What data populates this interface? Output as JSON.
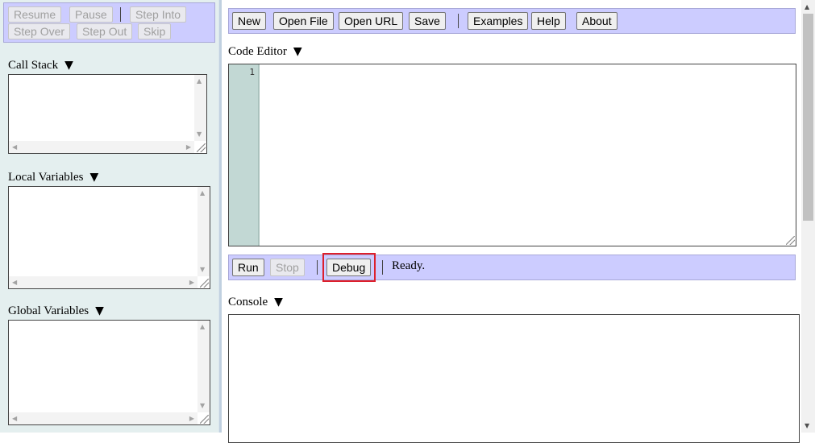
{
  "debug_toolbar": {
    "resume": "Resume",
    "pause": "Pause",
    "step_into": "Step Into",
    "step_over": "Step Over",
    "step_out": "Step Out",
    "skip": "Skip"
  },
  "left_panel": {
    "call_stack_label": "Call Stack",
    "local_variables_label": "Local Variables",
    "global_variables_label": "Global Variables",
    "collapse_glyph": "▼"
  },
  "toolbar": {
    "new": "New",
    "open_file": "Open File",
    "open_url": "Open URL",
    "save": "Save",
    "examples": "Examples",
    "help": "Help",
    "about": "About"
  },
  "editor": {
    "label": "Code Editor",
    "line_number": "1",
    "content": ""
  },
  "run_toolbar": {
    "run": "Run",
    "stop": "Stop",
    "debug": "Debug",
    "status": "Ready."
  },
  "console": {
    "label": "Console",
    "content": ""
  },
  "colors": {
    "toolbar_bg": "#ccccff",
    "left_panel_bg": "#e4efef",
    "gutter_bg": "#c2d8d4",
    "highlight": "#dd1f2c"
  }
}
